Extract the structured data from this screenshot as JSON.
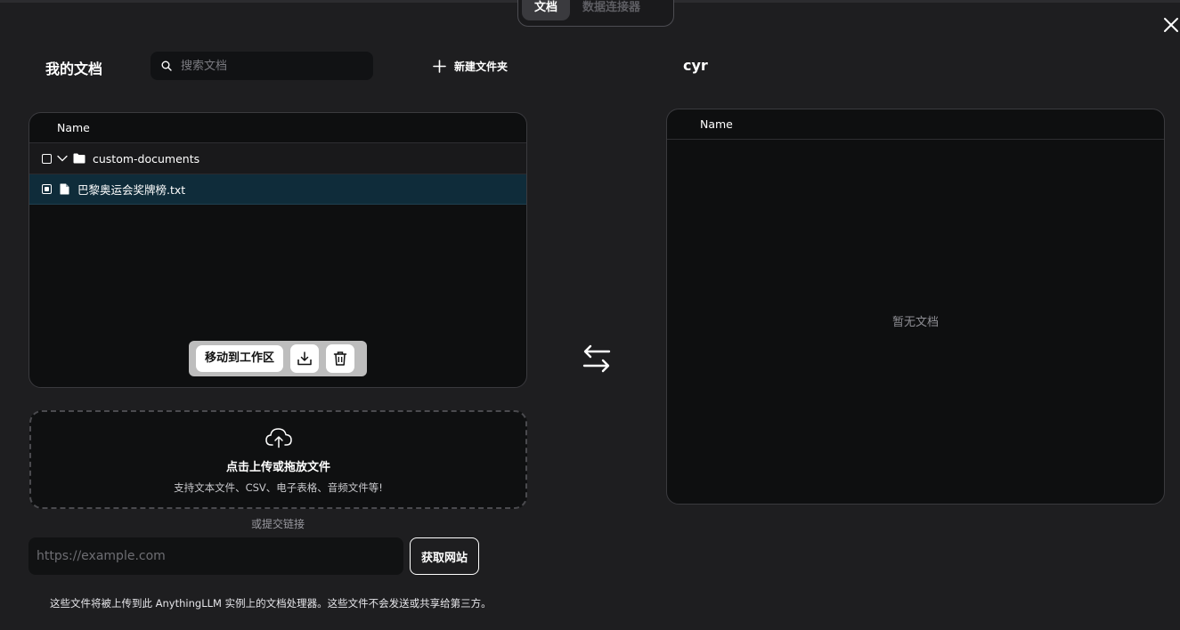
{
  "tabs": [
    {
      "label": "文档",
      "active": true
    },
    {
      "label": "数据连接器",
      "active": false
    }
  ],
  "left": {
    "title": "我的文档",
    "search_placeholder": "搜索文档",
    "new_folder_label": "新建文件夹",
    "column_header": "Name",
    "folder": {
      "name": "custom-documents",
      "checked": false,
      "expanded": true,
      "icon": "folder-icon"
    },
    "file": {
      "name": "巴黎奥运会奖牌榜.txt",
      "checked": true,
      "icon": "file-icon"
    },
    "actions": {
      "move_label": "移动到工作区",
      "download_icon": "tray-download-icon",
      "delete_icon": "trash-icon"
    }
  },
  "upload": {
    "title": "点击上传或拖放文件",
    "subtitle": "支持文本文件、CSV、电子表格、音频文件等!",
    "or_link": "或提交链接",
    "url_placeholder": "https://example.com",
    "fetch_label": "获取网站",
    "note": "这些文件将被上传到此 AnythingLLM 实例上的文档处理器。这些文件不会发送或共享给第三方。"
  },
  "right": {
    "workspace_name": "cyr",
    "column_header": "Name",
    "empty_text": "暂无文档"
  },
  "colors": {
    "background": "#1e1e20",
    "panel": "#0e0f10",
    "selected_row": "#0f2c3a",
    "action_bar": "#bdbdbd"
  }
}
